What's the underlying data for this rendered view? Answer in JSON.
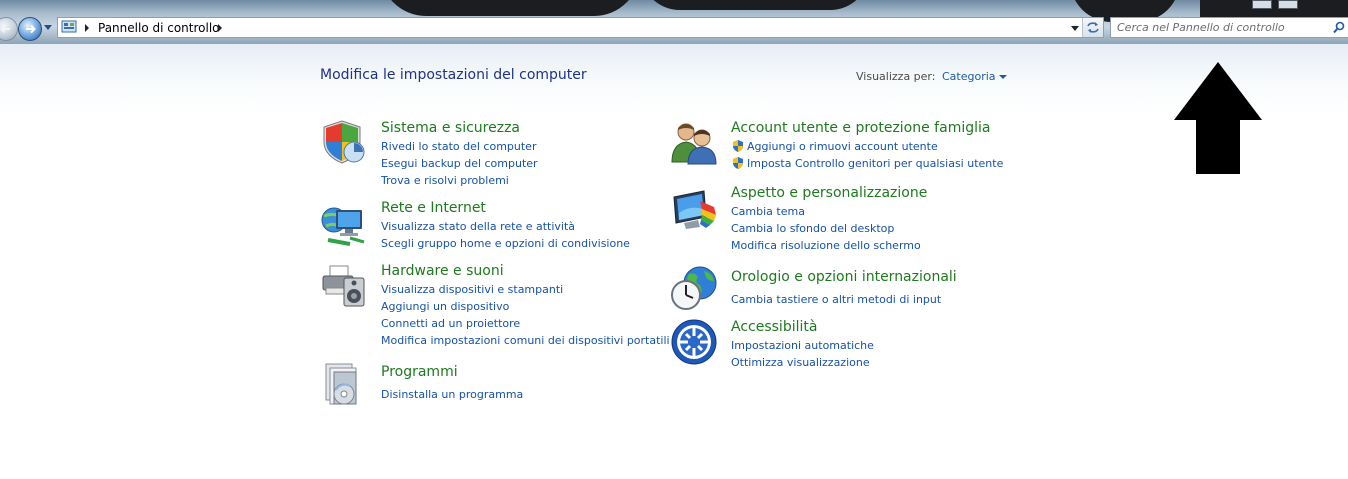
{
  "toolbar": {
    "breadcrumb": "Pannello di controllo",
    "search_placeholder": "Cerca nel Pannello di controllo"
  },
  "header": {
    "title": "Modifica le impostazioni del computer",
    "view_by_label": "Visualizza per:",
    "view_by_value": "Categoria"
  },
  "left_categories": [
    {
      "title": "Sistema e sicurezza",
      "icon": "security-shield-icon",
      "links": [
        "Rivedi lo stato del computer",
        "Esegui backup del computer",
        "Trova e risolvi problemi"
      ]
    },
    {
      "title": "Rete e Internet",
      "icon": "network-icon",
      "links": [
        "Visualizza stato della rete e attività",
        "Scegli gruppo home e opzioni di condivisione"
      ]
    },
    {
      "title": "Hardware e suoni",
      "icon": "printer-speaker-icon",
      "links": [
        "Visualizza dispositivi e stampanti",
        "Aggiungi un dispositivo",
        "Connetti ad un proiettore",
        "Modifica impostazioni comuni dei dispositivi portatili"
      ]
    },
    {
      "title": "Programmi",
      "icon": "programs-icon",
      "links": [
        "Disinstalla un programma"
      ]
    }
  ],
  "right_categories": [
    {
      "title": "Account utente e protezione famiglia",
      "icon": "users-icon",
      "links": [
        "Aggiungi o rimuovi account utente",
        "Imposta Controllo genitori per qualsiasi utente"
      ]
    },
    {
      "title": "Aspetto e personalizzazione",
      "icon": "display-appearance-icon",
      "links": [
        "Cambia tema",
        "Cambia lo sfondo del desktop",
        "Modifica risoluzione dello schermo"
      ]
    },
    {
      "title": "Orologio e opzioni internazionali",
      "icon": "clock-globe-icon",
      "links": [
        "Cambia tastiere o altri metodi di input"
      ]
    },
    {
      "title": "Accessibilità",
      "icon": "accessibility-icon",
      "links": [
        "Impostazioni automatiche",
        "Ottimizza visualizzazione"
      ]
    }
  ],
  "colors": {
    "title_green": "#1e7a1e",
    "link_blue": "#1652a8",
    "header_blue": "#1e3287"
  }
}
